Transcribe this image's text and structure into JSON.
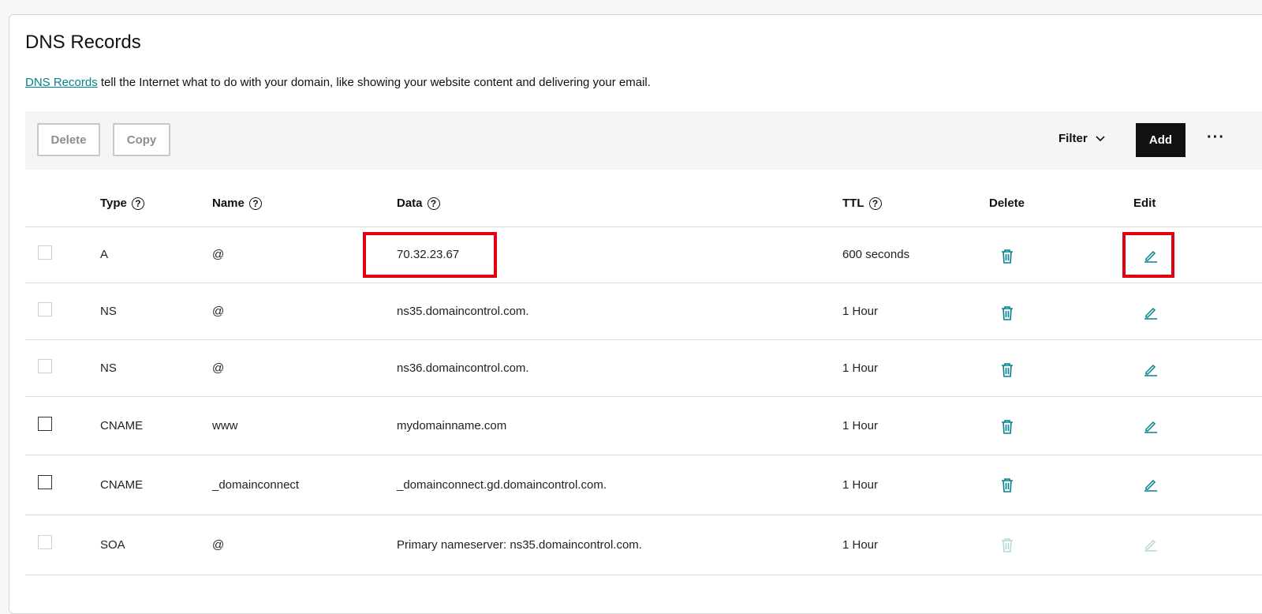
{
  "header": {
    "title": "DNS Records",
    "intro_link": "DNS Records",
    "intro_text": " tell the Internet what to do with your domain, like showing your website content and delivering your email."
  },
  "toolbar": {
    "delete_label": "Delete",
    "copy_label": "Copy",
    "filter_label": "Filter",
    "add_label": "Add",
    "more_label": "···"
  },
  "columns": {
    "type": "Type",
    "name": "Name",
    "data": "Data",
    "ttl": "TTL",
    "delete": "Delete",
    "edit": "Edit",
    "help_glyph": "?"
  },
  "records": [
    {
      "type": "A",
      "name": "@",
      "data": "70.32.23.67",
      "ttl": "600 seconds"
    },
    {
      "type": "NS",
      "name": "@",
      "data": "ns35.domaincontrol.com.",
      "ttl": "1 Hour"
    },
    {
      "type": "NS",
      "name": "@",
      "data": "ns36.domaincontrol.com.",
      "ttl": "1 Hour"
    },
    {
      "type": "CNAME",
      "name": "www",
      "data": "mydomainname.com",
      "ttl": "1 Hour"
    },
    {
      "type": "CNAME",
      "name": "_domainconnect",
      "data": "_domainconnect.gd.domaincontrol.com.",
      "ttl": "1 Hour"
    },
    {
      "type": "SOA",
      "name": "@",
      "data": "Primary nameserver: ns35.domaincontrol.com.",
      "ttl": "1 Hour"
    }
  ],
  "colors": {
    "accent": "#00838c",
    "highlight": "#e0000e",
    "dark_button": "#111111"
  }
}
